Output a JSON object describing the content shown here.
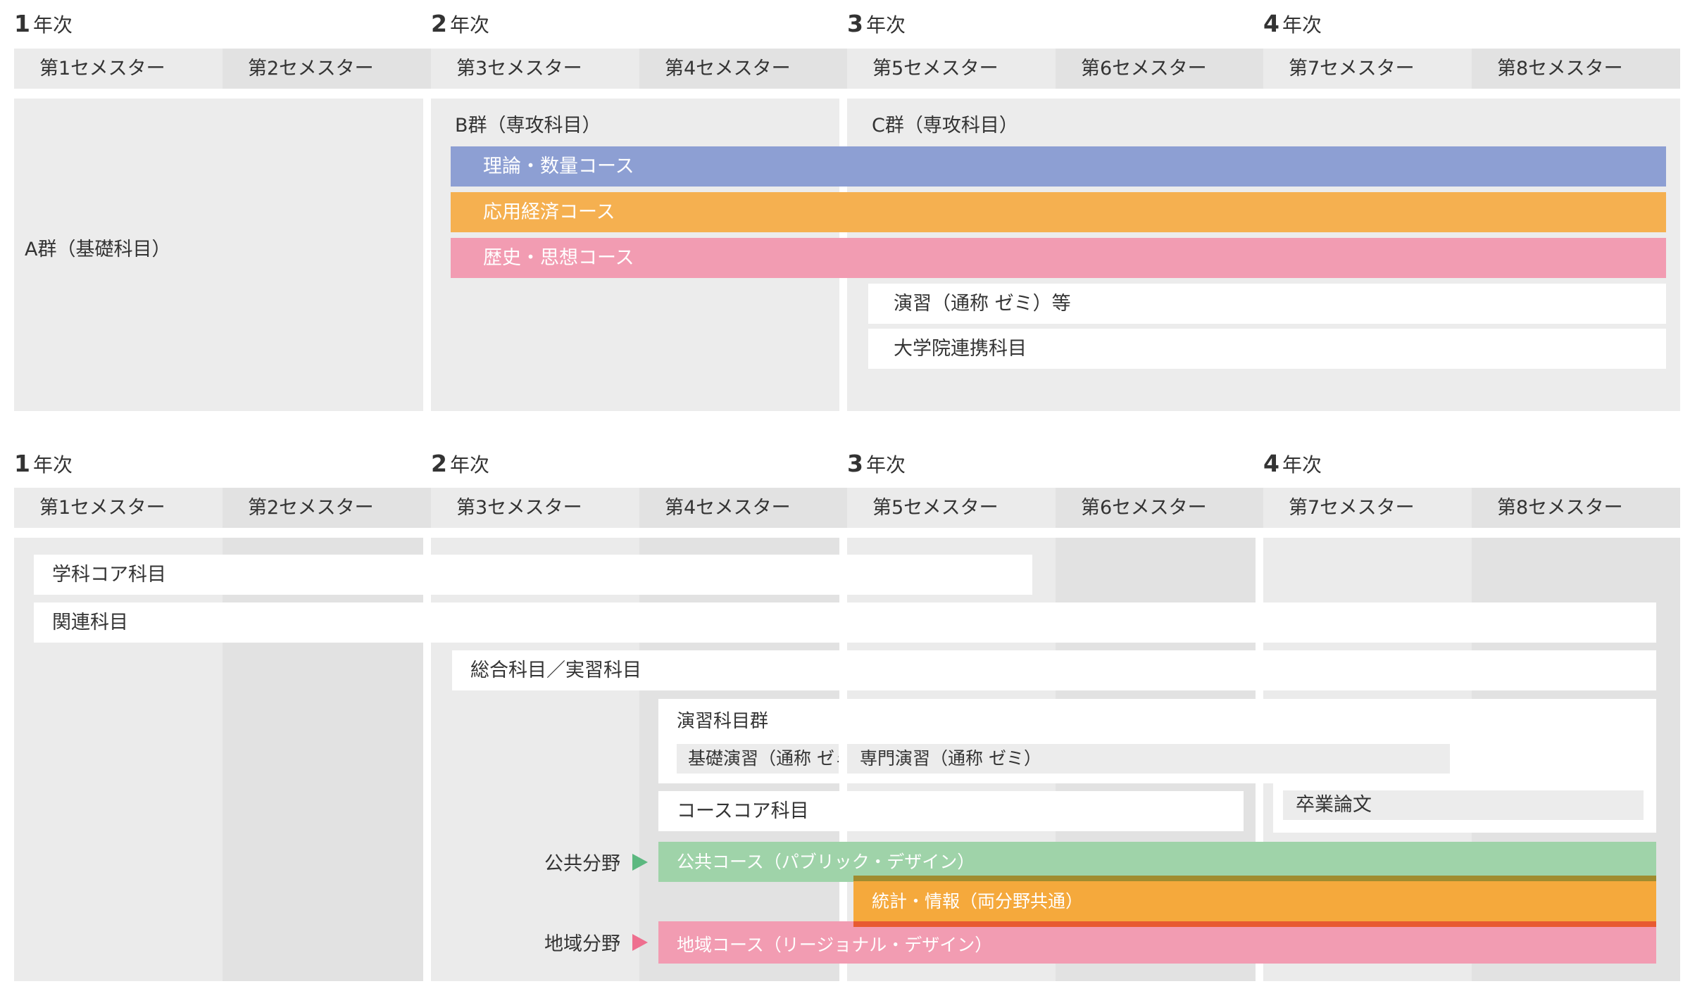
{
  "colors": {
    "theory": "#8d9fd3",
    "applied": "#f5b050",
    "history": "#f29cb2",
    "public": "#9fd3a9",
    "stats": "#f5a93c",
    "regional": "#f29cb2",
    "public_arrow": "#5cb880",
    "regional_arrow": "#ee6f8f",
    "stats_stripe_top": "#a08c2f",
    "stats_stripe_bottom": "#e85a31"
  },
  "years": [
    {
      "num": "1",
      "suffix": "年次"
    },
    {
      "num": "2",
      "suffix": "年次"
    },
    {
      "num": "3",
      "suffix": "年次"
    },
    {
      "num": "4",
      "suffix": "年次"
    }
  ],
  "semesters": [
    "第1セメスター",
    "第2セメスター",
    "第3セメスター",
    "第4セメスター",
    "第5セメスター",
    "第6セメスター",
    "第7セメスター",
    "第8セメスター"
  ],
  "diagram1": {
    "group_a": "A群（基礎科目）",
    "group_b": "B群（専攻科目）",
    "group_c": "C群（専攻科目）",
    "course_theory": "理論・数量コース",
    "course_applied": "応用経済コース",
    "course_history": "歴史・思想コース",
    "seminar": "演習（通称 ゼミ）等",
    "graduate": "大学院連携科目"
  },
  "diagram2": {
    "core": "学科コア科目",
    "related": "関連科目",
    "general": "総合科目／実習科目",
    "seminar_group": "演習科目群",
    "basic_seminar": "基礎演習（通称 ゼミ）",
    "special_seminar": "専門演習（通称 ゼミ）",
    "thesis": "卒業論文",
    "course_core": "コースコア科目",
    "public_field": "公共分野",
    "regional_field": "地域分野",
    "public_course": "公共コース（パブリック・デザイン）",
    "stats_course": "統計・情報（両分野共通）",
    "regional_course": "地域コース（リージョナル・デザイン）"
  }
}
